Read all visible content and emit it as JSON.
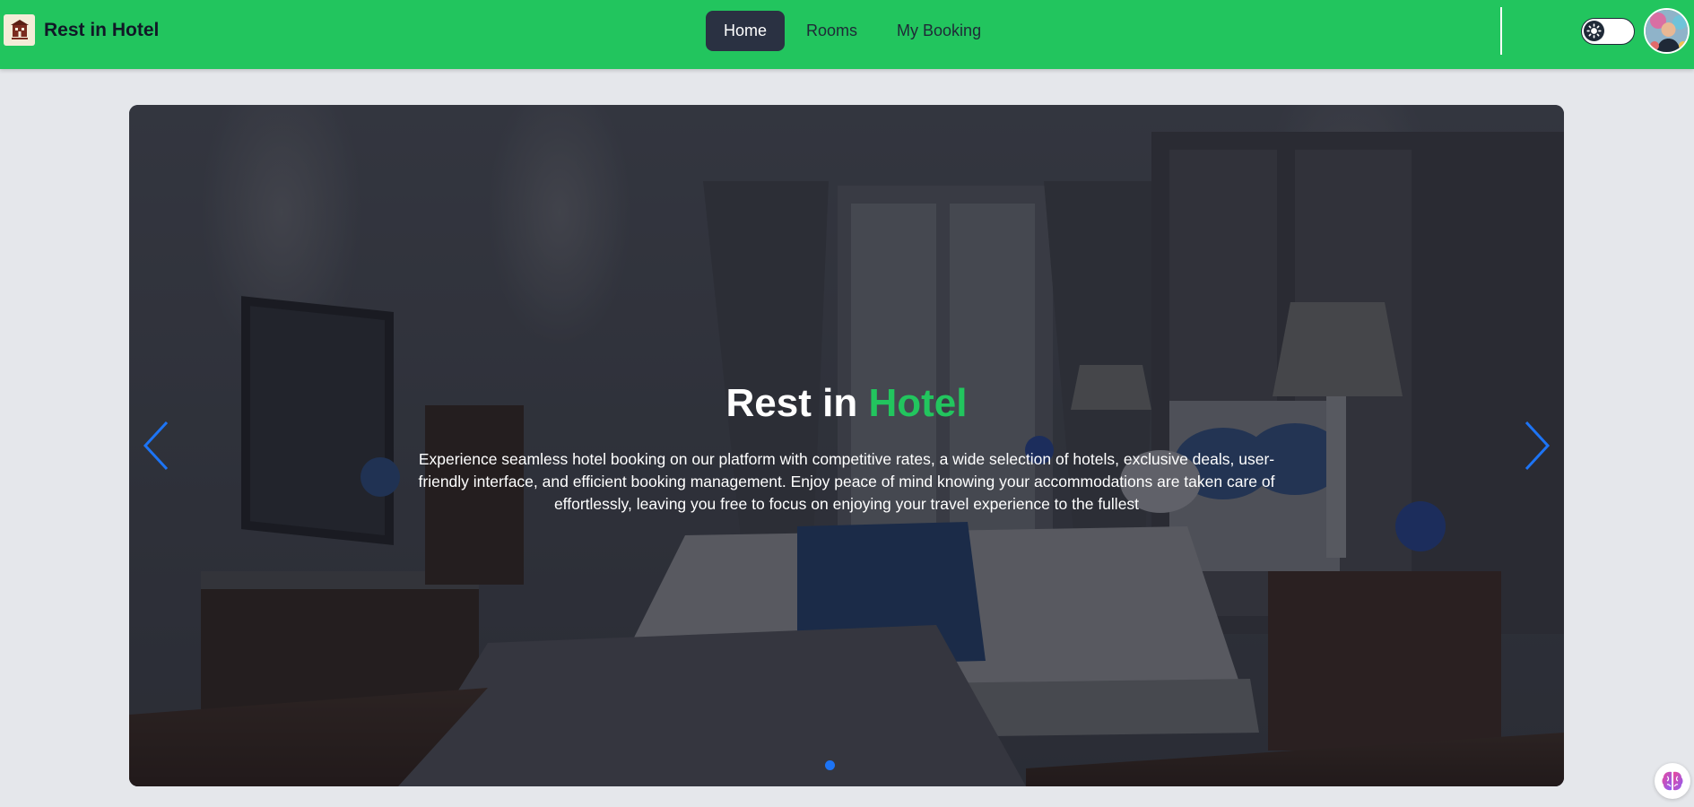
{
  "navbar": {
    "brand_name": "Rest in Hotel",
    "brand_logo_icon": "hotel-logo-icon",
    "menu": [
      {
        "label": "Home",
        "active": true
      },
      {
        "label": "Rooms",
        "active": false
      },
      {
        "label": "My Booking",
        "active": false
      }
    ],
    "theme_toggle_icon": "sun-icon",
    "avatar": "user-avatar"
  },
  "hero": {
    "title_main": "Rest in ",
    "title_accent": "Hotel",
    "description": "Experience seamless hotel booking on our platform with competitive rates, a wide selection of hotels, exclusive deals, user-friendly interface, and efficient booking management. Enjoy peace of mind knowing your accommodations are taken care of effortlessly, leaving you free to focus on enjoying your travel experience to the fullest",
    "prev_icon": "chevron-left-icon",
    "next_icon": "chevron-right-icon",
    "active_slide": 1,
    "slide_count": 1
  },
  "floating_widget_icon": "brain-icon",
  "colors": {
    "navbar_bg": "#22c55e",
    "accent": "#22c55e",
    "active_nav_bg": "#2a3142",
    "arrow": "#1d74f5",
    "page_bg": "#e5e7eb"
  }
}
